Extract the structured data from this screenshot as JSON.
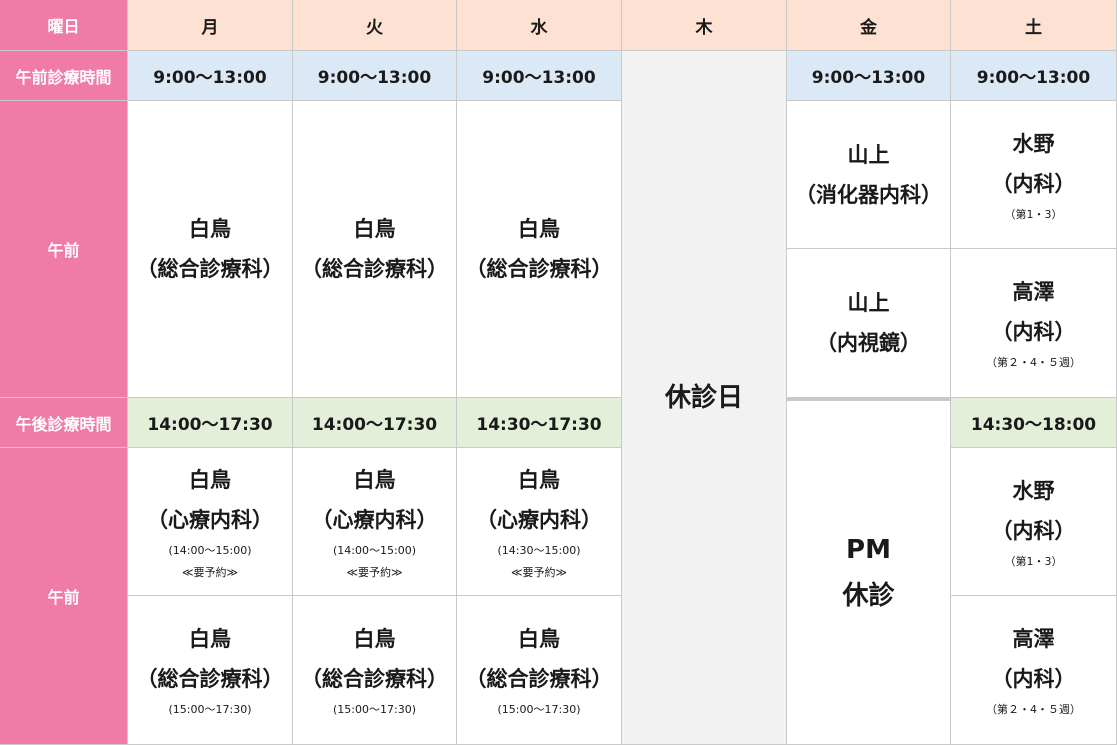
{
  "header": {
    "corner": "曜日",
    "days": [
      "月",
      "火",
      "水",
      "木",
      "金",
      "土"
    ]
  },
  "rows": {
    "am_time_label": "午前診療時間",
    "am_label": "午前",
    "pm_time_label": "午後診療時間",
    "pm_label": "午前"
  },
  "am_times": {
    "mon": "9:00～13:00",
    "tue": "9:00～13:00",
    "wed": "9:00～13:00",
    "fri": "9:00～13:00",
    "sat": "9:00～13:00"
  },
  "am": {
    "mon": {
      "name": "白鳥",
      "dept": "（総合診療科）"
    },
    "tue": {
      "name": "白鳥",
      "dept": "（総合診療科）"
    },
    "wed": {
      "name": "白鳥",
      "dept": "（総合診療科）"
    },
    "fri1": {
      "name": "山上",
      "dept": "（消化器内科）"
    },
    "fri2": {
      "name": "山上",
      "dept": "（内視鏡）"
    },
    "sat1": {
      "name": "水野",
      "dept": "（内科）",
      "note": "（第1・3）"
    },
    "sat2": {
      "name": "高澤",
      "dept": "（内科）",
      "note": "（第２・4・５週）"
    }
  },
  "thursday": {
    "closed_label": "休診日"
  },
  "friday_pm": {
    "line1": "PM",
    "line2": "休診"
  },
  "pm_times": {
    "mon": "14:00～17:30",
    "tue": "14:00～17:30",
    "wed": "14:30～17:30",
    "sat": "14:30～18:00"
  },
  "pm": {
    "mon1": {
      "name": "白鳥",
      "dept": "（心療内科）",
      "time": "(14:00～15:00)",
      "reserve": "≪要予約≫"
    },
    "tue1": {
      "name": "白鳥",
      "dept": "（心療内科）",
      "time": "(14:00～15:00)",
      "reserve": "≪要予約≫"
    },
    "wed1": {
      "name": "白鳥",
      "dept": "（心療内科）",
      "time": "(14:30～15:00)",
      "reserve": "≪要予約≫"
    },
    "sat1": {
      "name": "水野",
      "dept": "（内科）",
      "note": "（第1・3）"
    },
    "mon2": {
      "name": "白鳥",
      "dept": "（総合診療科）",
      "time": "(15:00～17:30)"
    },
    "tue2": {
      "name": "白鳥",
      "dept": "（総合診療科）",
      "time": "(15:00～17:30)"
    },
    "wed2": {
      "name": "白鳥",
      "dept": "（総合診療科）",
      "time": "(15:00～17:30)"
    },
    "sat2": {
      "name": "高澤",
      "dept": "（内科）",
      "note": "（第２・4・５週）"
    }
  }
}
